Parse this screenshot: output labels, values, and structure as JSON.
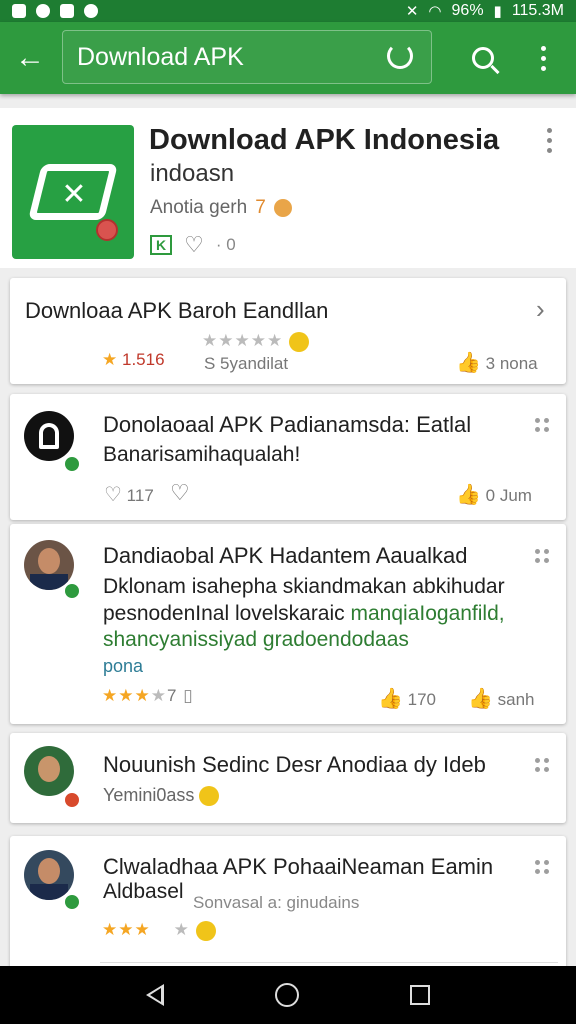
{
  "status_bar": {
    "battery": "96%",
    "data": "115.3M"
  },
  "toolbar": {
    "search_text": "Download APK"
  },
  "app": {
    "title": "Download APK Indonesia",
    "subtitle": "indoasn",
    "meta": "Anotia gerh",
    "meta_num": "7",
    "size_badge": "K",
    "rating_sep": "· 0"
  },
  "rows": [
    {
      "title": "Downloaa APK Baroh Eandllan",
      "rating_value": "1.516",
      "rating_label": "S 5yandilat",
      "action": "3 nona"
    },
    {
      "title": "Donolaoaal APK Padianamsda: Eatlal",
      "subtitle": "Banarisamihaqualah!",
      "likes": "117",
      "action": "0 Jum"
    },
    {
      "title": "Dandiaobal APK Hadantem Aaualkad",
      "line2": "Dklonam isahepha skiandmakan abkihudar",
      "line3_plain": "pesnodenInal lovelskaraic ",
      "line3_green": "manqiaIoganfild,",
      "line4": "shancyanissiyad gradoendodaas",
      "line5": "pona",
      "rating_count": "7",
      "likes": "170",
      "action": "sanh"
    },
    {
      "title": "Nouunish  Sedinc Desr Anodiaa dy  Ideb",
      "subtitle": "Yemini0ass"
    },
    {
      "title": "Clwaladhaa APK PohaaiNeaman Eamin",
      "subtitle": "Aldbasel",
      "subtitle_extra": "Sonvasal a: ginudains"
    }
  ],
  "colors": {
    "toolbar": "#2e9a3e",
    "status": "#1e7d32",
    "star": "#f5a623"
  }
}
